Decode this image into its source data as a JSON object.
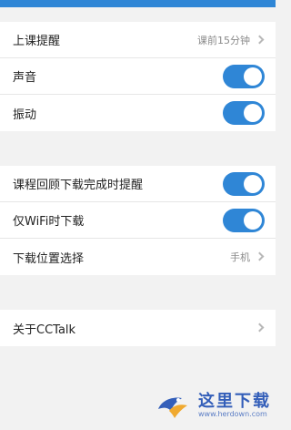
{
  "colors": {
    "accent": "#2f86d6",
    "background": "#f2f2f2",
    "row_background": "#ffffff",
    "divider": "#e6e6e6",
    "text_primary": "#222222",
    "text_secondary": "#8a8a8a",
    "chevron": "#b8b8b8",
    "watermark": "#1f4fb3"
  },
  "settings": {
    "group1": {
      "class_reminder": {
        "label": "上课提醒",
        "value": "课前15分钟",
        "icon": "chevron-right-icon"
      },
      "sound": {
        "label": "声音",
        "toggle_on": true
      },
      "vibration": {
        "label": "振动",
        "toggle_on": true
      }
    },
    "group2": {
      "review_download_notify": {
        "label": "课程回顾下载完成时提醒",
        "toggle_on": true
      },
      "wifi_only_download": {
        "label": "仅WiFi时下载",
        "toggle_on": true
      },
      "download_location": {
        "label": "下载位置选择",
        "value": "手机",
        "icon": "chevron-right-icon"
      }
    },
    "group3": {
      "about": {
        "label": "关于CCTalk",
        "icon": "chevron-right-icon"
      }
    }
  },
  "watermark": {
    "title": "这里下载",
    "url": "www.herdown.com",
    "logo": "bird-logo-icon"
  }
}
